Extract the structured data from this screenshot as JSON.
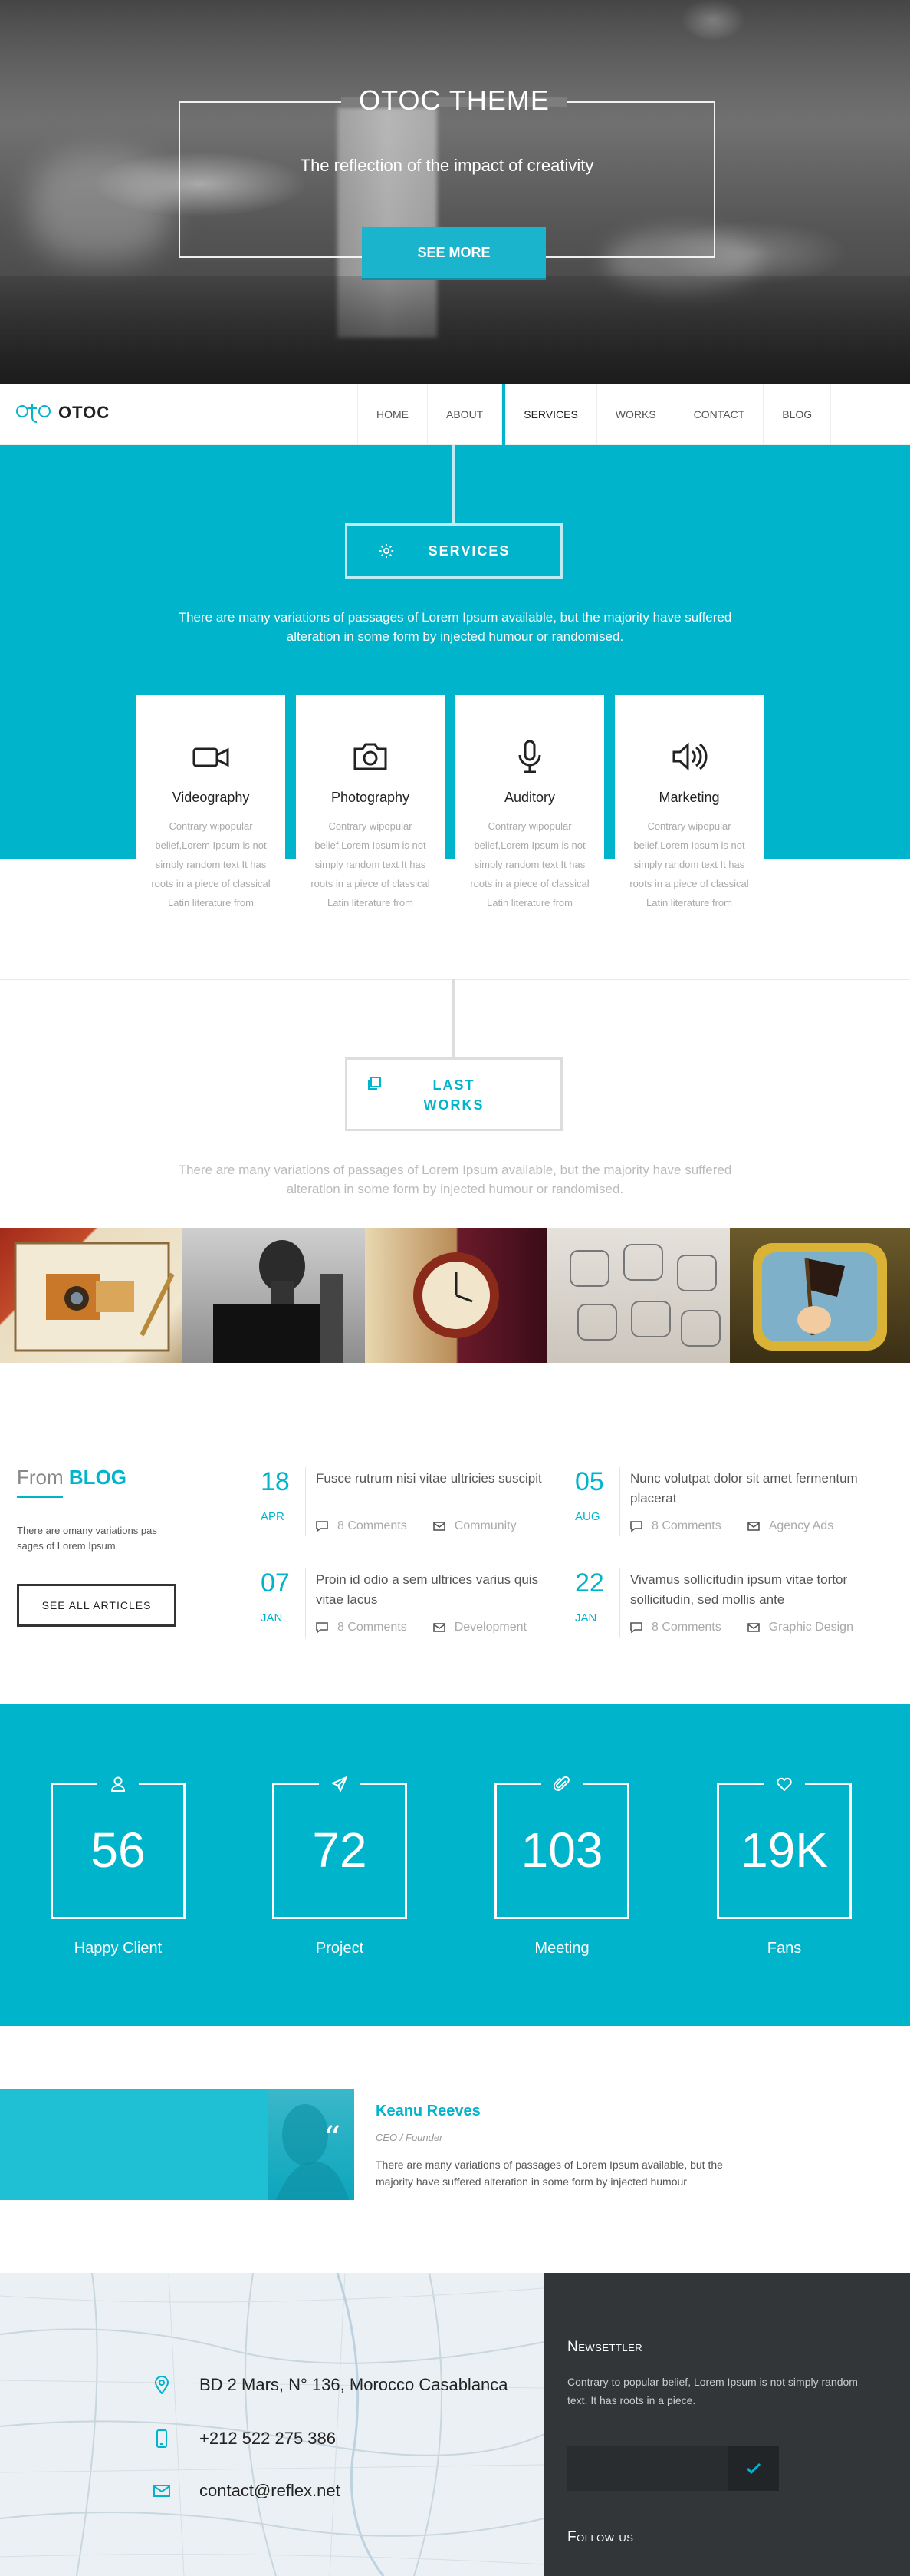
{
  "hero": {
    "title": "OTOC THEME",
    "tagline": "The reflection of the impact of creativity",
    "button": "SEE MORE"
  },
  "nav": {
    "logo_mark": "oto",
    "logo_text": "OTOC",
    "items": [
      "HOME",
      "ABOUT",
      "SERVICES",
      "WORKS",
      "CONTACT",
      "BLOG"
    ],
    "active": "SERVICES"
  },
  "services": {
    "heading": "SERVICES",
    "description": "There are many variations of passages of Lorem Ipsum available, but the majority have suffered alteration in some form by injected humour or randomised.",
    "cards": [
      {
        "icon": "video-camera-icon",
        "title": "Videography",
        "text": "Contrary wipopular belief,Lorem Ipsum is not simply random text It has roots in a piece of classical Latin literature from"
      },
      {
        "icon": "camera-icon",
        "title": "Photography",
        "text": "Contrary wipopular belief,Lorem Ipsum is not simply random text It has roots in a piece of classical Latin literature from"
      },
      {
        "icon": "microphone-icon",
        "title": "Auditory",
        "text": "Contrary wipopular belief,Lorem Ipsum is not simply random text It has roots in a piece of classical Latin literature from"
      },
      {
        "icon": "speaker-icon",
        "title": "Marketing",
        "text": "Contrary wipopular belief,Lorem Ipsum is not simply random text It has roots in a piece of classical Latin literature from"
      }
    ]
  },
  "works": {
    "heading_line1": "LAST",
    "heading_line2": "WORKS",
    "description": "There are many variations of passages of Lorem Ipsum available, but the majority have suffered alteration in some form by injected humour or randomised."
  },
  "blog": {
    "heading_pre": "From",
    "heading_accent": "BLOG",
    "description": "There are omany variations pas sages of Lorem Ipsum.",
    "button": "SEE ALL ARTICLES",
    "posts": [
      {
        "day": "18",
        "month": "APR",
        "title": "Fusce rutrum nisi vitae ultricies suscipit",
        "comments": "8 Comments",
        "category": "Community"
      },
      {
        "day": "05",
        "month": "AUG",
        "title": "Nunc volutpat dolor sit amet fermentum placerat",
        "comments": "8 Comments",
        "category": "Agency Ads"
      },
      {
        "day": "07",
        "month": "JAN",
        "title": "Proin id odio a sem ultrices varius quis vitae lacus",
        "comments": "8 Comments",
        "category": "Development"
      },
      {
        "day": "22",
        "month": "JAN",
        "title": "Vivamus sollicitudin ipsum vitae tortor sollicitudin, sed mollis ante",
        "comments": "8 Comments",
        "category": "Graphic Design"
      }
    ]
  },
  "stats": [
    {
      "icon": "user-icon",
      "value": "56",
      "label": "Happy Client"
    },
    {
      "icon": "send-icon",
      "value": "72",
      "label": "Project"
    },
    {
      "icon": "paperclip-icon",
      "value": "103",
      "label": "Meeting"
    },
    {
      "icon": "heart-icon",
      "value": "19K",
      "label": "Fans"
    }
  ],
  "testimonial": {
    "name": "Keanu Reeves",
    "role": "CEO / Founder",
    "text": "There are many variations of passages of Lorem Ipsum available, but the majority have suffered alteration in some form by injected humour"
  },
  "contact": {
    "address": "BD 2 Mars, N° 136, Morocco Casablanca",
    "phone": "+212 522 275 386",
    "email": "contact@reflex.net"
  },
  "newsletter": {
    "title": "Newsettler",
    "description": "Contrary to popular belief, Lorem Ipsum is not simply random text. It has roots in a piece.",
    "follow": "Follow us"
  },
  "colors": {
    "accent": "#00b4cc",
    "dark": "#323639"
  }
}
